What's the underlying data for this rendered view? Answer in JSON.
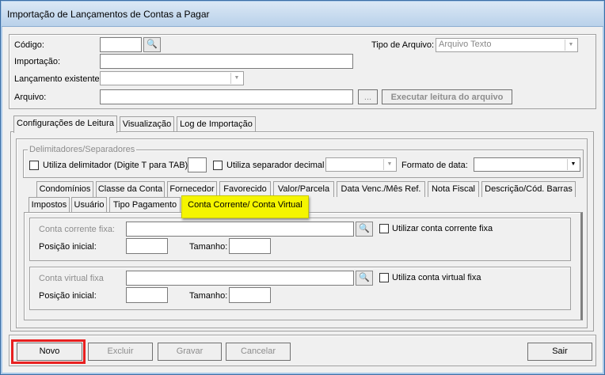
{
  "window": {
    "title": "Importação de Lançamentos de Contas a Pagar"
  },
  "header": {
    "codigo_label": "Código:",
    "codigo_value": "",
    "tipo_label": "Tipo de Arquivo:",
    "tipo_value": "Arquivo Texto",
    "importacao_label": "Importação:",
    "importacao_value": "",
    "lancamento_label": "Lançamento existente:",
    "lancamento_value": "",
    "arquivo_label": "Arquivo:",
    "arquivo_value": "",
    "browse_label": "...",
    "executar_label": "Executar leitura do arquivo"
  },
  "tabs": [
    {
      "label": "Configurações de Leitura",
      "selected": true
    },
    {
      "label": "Visualização"
    },
    {
      "label": "Log de Importação"
    }
  ],
  "delimitadores": {
    "legend": "Delimitadores/Separadores",
    "utiliza_delimitador": "Utiliza delimitador (Digite T para TAB)",
    "delimitador_value": "",
    "utiliza_separador": "Utiliza separador decimal",
    "separador_value": "",
    "formato_label": "Formato de data:",
    "formato_value": ""
  },
  "subtabs_row1": [
    "Condomínios",
    "Classe da Conta",
    "Fornecedor",
    "Favorecido",
    "Valor/Parcela",
    "Data Venc./Mês Ref.",
    "Nota Fiscal",
    "Descrição/Cód. Barras"
  ],
  "subtabs_row2": [
    "Impostos",
    "Usuário",
    "Tipo Pagamento",
    "Conta Corrente/ Conta Virtual"
  ],
  "highlight_color": "#f5f500",
  "conta_corrente": {
    "label": "Conta corrente fixa:",
    "value": "",
    "check": "Utilizar conta corrente fixa",
    "pos_label": "Posição inicial:",
    "tam_label": "Tamanho:"
  },
  "conta_virtual": {
    "label": "Conta virtual fixa",
    "value": "",
    "check": "Utiliza conta virtual fixa",
    "pos_label": "Posição inicial:",
    "tam_label": "Tamanho:"
  },
  "footer": {
    "novo": "Novo",
    "excluir": "Excluir",
    "gravar": "Gravar",
    "cancelar": "Cancelar",
    "sair": "Sair",
    "highlight_color": "#e82020"
  }
}
